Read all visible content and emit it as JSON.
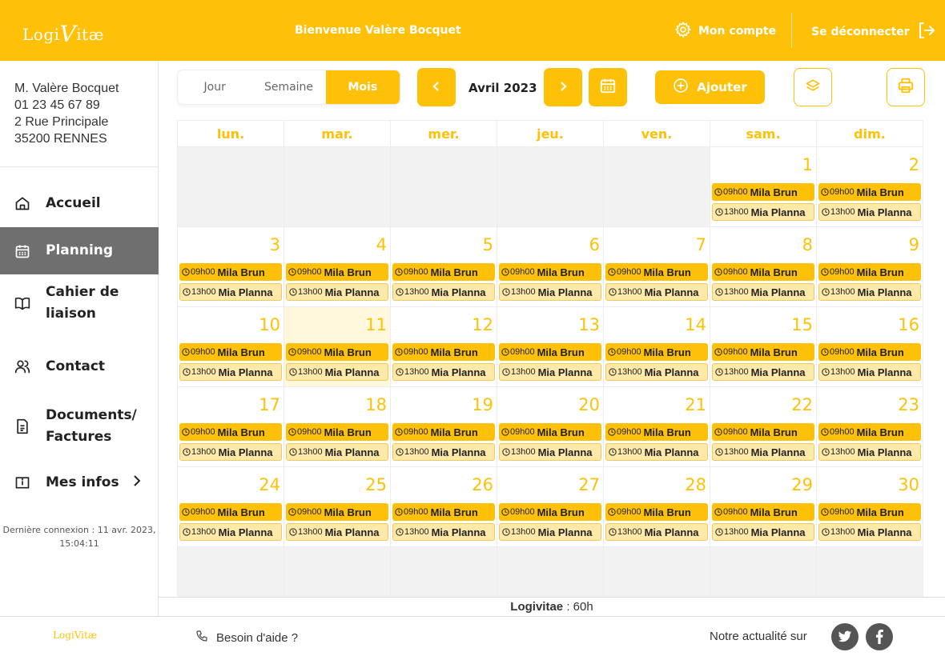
{
  "colors": {
    "accent": "#FFC107",
    "active_nav": "#6F6F6F"
  },
  "header": {
    "logo_prefix": "Logi",
    "logo_v": "V",
    "logo_suffix": "itæ",
    "welcome": "Bienvenue Valère Bocquet",
    "account": "Mon compte",
    "logout": "Se déconnecter",
    "account_icon": "gear-icon",
    "logout_icon": "logout-icon"
  },
  "user": {
    "name": "M. Valère Bocquet",
    "phone": "01 23 45 67 89",
    "street": "2 Rue Principale",
    "city": "35200 RENNES"
  },
  "nav": [
    {
      "label": "Accueil",
      "icon": "home-icon",
      "active": false
    },
    {
      "label": "Planning",
      "icon": "calendar-icon",
      "active": true
    },
    {
      "label1": "Cahier de",
      "label2": "liaison",
      "icon": "book-icon",
      "active": false
    },
    {
      "label": "Contact",
      "icon": "users-icon",
      "active": false
    },
    {
      "label1": "Documents/",
      "label2": "Factures",
      "icon": "document-icon",
      "active": false
    },
    {
      "label": "Mes infos",
      "icon": "info-icon",
      "active": false
    }
  ],
  "last_login": {
    "line1": "Dernière connexion : 11 avr. 2023,",
    "line2": "15:04:11"
  },
  "toolbar": {
    "views": [
      "Jour",
      "Semaine",
      "Mois"
    ],
    "selected_view": "Mois",
    "month": "Avril 2023",
    "add": "Ajouter"
  },
  "calendar": {
    "weekdays": [
      "lun.",
      "mar.",
      "mer.",
      "jeu.",
      "ven.",
      "sam.",
      "dim."
    ],
    "leading_empty": 5,
    "days_in_month": 30,
    "today": 11,
    "events": [
      {
        "time": "09h00",
        "name": "Mila Brun"
      },
      {
        "time": "13h00",
        "name": "Mia Planna"
      }
    ]
  },
  "total": {
    "label": "Logivitae",
    "value": " : 60h"
  },
  "footer": {
    "logo": "LogiVitæ",
    "help": "Besoin d'aide ?",
    "news": "Notre actualité sur",
    "social": [
      "twitter-icon",
      "facebook-icon"
    ]
  }
}
